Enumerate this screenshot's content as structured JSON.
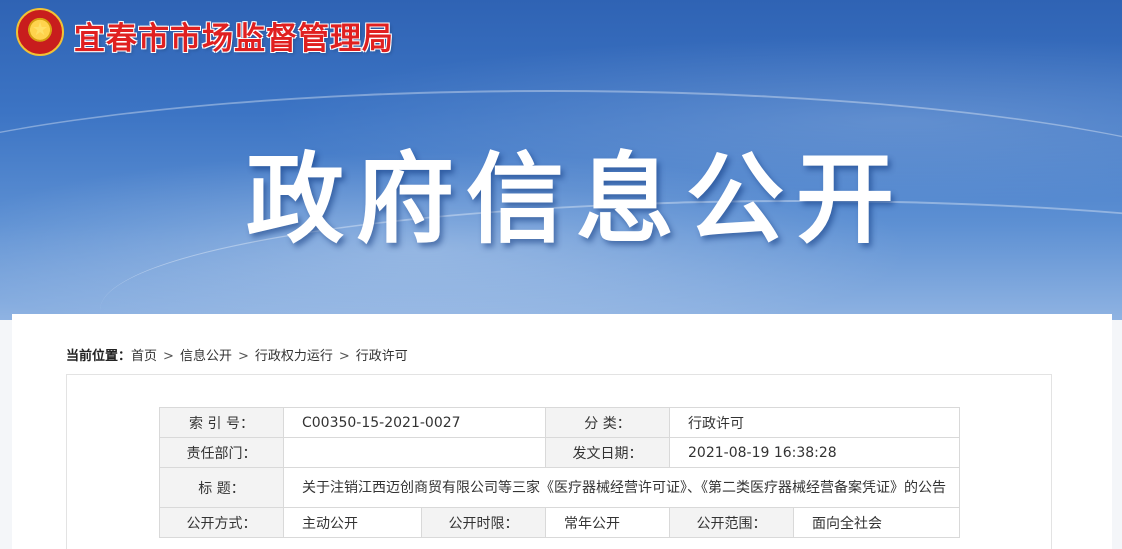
{
  "header": {
    "org_name": "宜春市市场监督管理局",
    "banner_title": "政府信息公开"
  },
  "breadcrumb": {
    "lead": "当前位置：",
    "items": [
      "首页",
      "信息公开",
      "行政权力运行",
      "行政许可"
    ],
    "separator": ">"
  },
  "meta_table": {
    "index_label": "索 引 号：",
    "index_value": "C00350-15-2021-0027",
    "category_label": "分    类：",
    "category_value": "行政许可",
    "dept_label": "责任部门：",
    "dept_value": "",
    "date_label": "发文日期：",
    "date_value": "2021-08-19 16:38:28",
    "title_label": "标    题：",
    "title_value": "关于注销江西迈创商贸有限公司等三家《医疗器械经营许可证》、《第二类医疗器械经营备案凭证》的公告",
    "mode_label": "公开方式：",
    "mode_value": "主动公开",
    "period_label": "公开时限：",
    "period_value": "常年公开",
    "scope_label": "公开范围：",
    "scope_value": "面向全社会"
  }
}
